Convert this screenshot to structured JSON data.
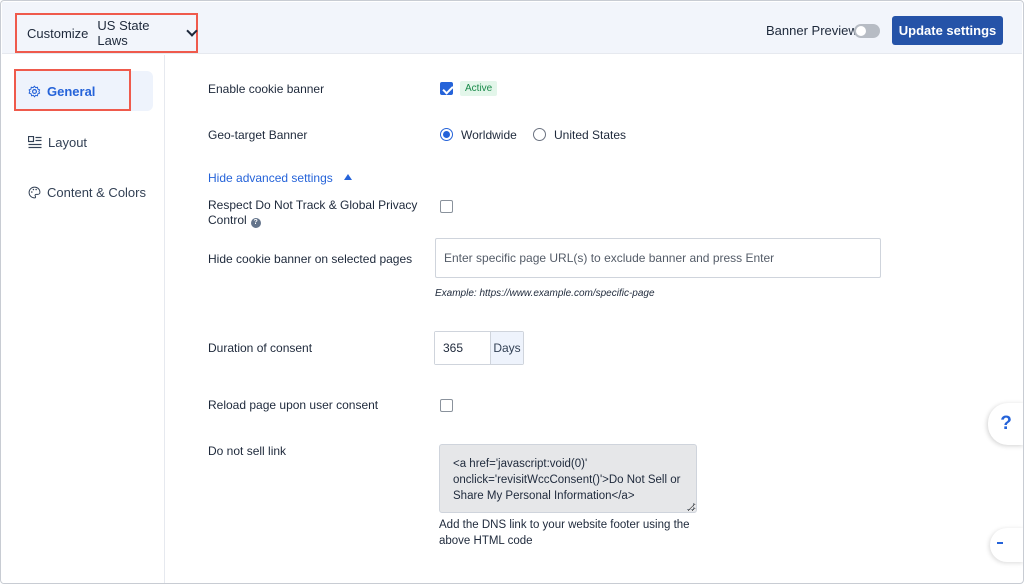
{
  "header": {
    "customize_label": "Customize",
    "customize_value": "US State Laws",
    "banner_preview_label": "Banner Preview",
    "banner_preview_on": false,
    "update_button_label": "Update settings"
  },
  "sidebar": {
    "items": [
      {
        "label": "General",
        "icon": "gear-icon",
        "active": true
      },
      {
        "label": "Layout",
        "icon": "layout-icon",
        "active": false
      },
      {
        "label": "Content & Colors",
        "icon": "palette-icon",
        "active": false
      }
    ]
  },
  "settings": {
    "enable_banner": {
      "label": "Enable cookie banner",
      "checked": true,
      "badge": "Active"
    },
    "geo_target": {
      "label": "Geo-target Banner",
      "options": [
        "Worldwide",
        "United States"
      ],
      "selected": "Worldwide"
    },
    "advanced_toggle_label": "Hide advanced settings",
    "dnt": {
      "label": "Respect Do Not Track & Global Privacy Control",
      "checked": false
    },
    "hide_pages": {
      "label": "Hide cookie banner on selected pages",
      "placeholder": "Enter specific page URL(s) to exclude banner and press Enter",
      "value": "",
      "example": "Example: https://www.example.com/specific-page"
    },
    "duration": {
      "label": "Duration of consent",
      "value": "365",
      "unit": "Days"
    },
    "reload": {
      "label": "Reload page upon user consent",
      "checked": false
    },
    "dns": {
      "label": "Do not sell link",
      "code": "<a href='javascript:void(0)' onclick='revisitWccConsent()'>Do Not Sell or Share My Personal Information</a>",
      "help": "Add the DNS link to your website footer using the above HTML code"
    }
  },
  "floating": {
    "help_label": "?"
  },
  "colors": {
    "primary": "#2553a8",
    "accent": "#2563d9",
    "highlight": "#ef5a4c",
    "success": "#1a8a4a"
  }
}
